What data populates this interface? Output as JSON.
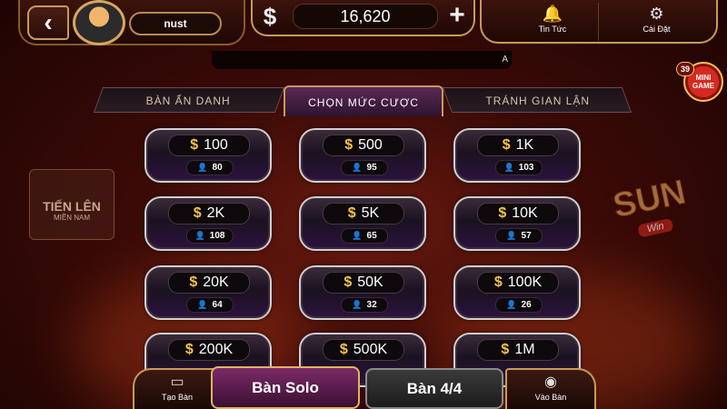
{
  "header": {
    "username": "nust",
    "balance": "16,620",
    "currency_symbol": "$",
    "plus_symbol": "+",
    "back_symbol": "‹",
    "news_label": "Tin Tức",
    "settings_label": "Cài Đặt",
    "marquee_text": "A"
  },
  "mini_game": {
    "label_line1": "MINI",
    "label_line2": "GAME",
    "badge": "39"
  },
  "tabs": [
    {
      "label": "BÀN ẨN DANH"
    },
    {
      "label": "CHỌN MỨC CƯỢC"
    },
    {
      "label": "TRÁNH GIAN LẬN"
    }
  ],
  "side_logos": {
    "left_line1": "TIẾN LÊN",
    "left_line2": "MIỀN NAM",
    "right_line1": "SUN",
    "right_line2": "Win"
  },
  "bets": [
    {
      "amount": "100",
      "players": "80"
    },
    {
      "amount": "500",
      "players": "95"
    },
    {
      "amount": "1K",
      "players": "103"
    },
    {
      "amount": "2K",
      "players": "108"
    },
    {
      "amount": "5K",
      "players": "65"
    },
    {
      "amount": "10K",
      "players": "57"
    },
    {
      "amount": "20K",
      "players": "64"
    },
    {
      "amount": "50K",
      "players": "32"
    },
    {
      "amount": "100K",
      "players": "26"
    },
    {
      "amount": "200K",
      "players": ""
    },
    {
      "amount": "500K",
      "players": ""
    },
    {
      "amount": "1M",
      "players": ""
    }
  ],
  "bet_coin_symbol": "$",
  "bottom": {
    "create_label": "Tạo Bàn",
    "solo_label": "Bàn Solo",
    "table44_label": "Bàn 4/4",
    "join_label": "Vào Bàn"
  },
  "colors": {
    "gold": "#c79a5a",
    "coin": "#f3c34a",
    "active_tab": "#5a2a55"
  }
}
